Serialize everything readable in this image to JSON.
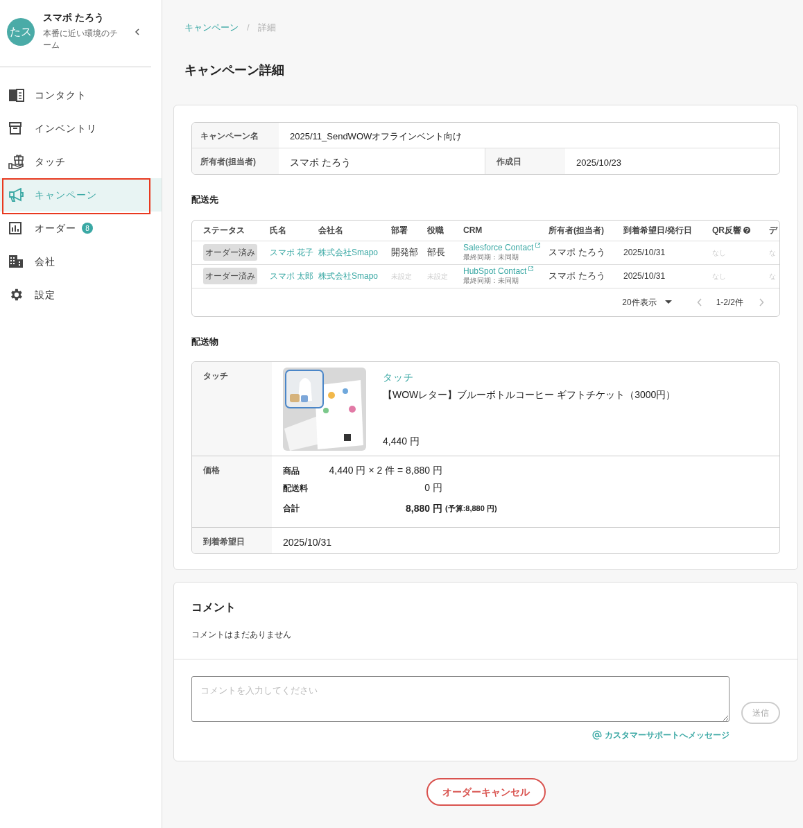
{
  "sidebar": {
    "user": {
      "avatar_text": "たス",
      "name": "スマポ たろう",
      "team": "本番に近い環境のチーム"
    },
    "nav": [
      {
        "label": "コンタクト",
        "selected": false,
        "annotated": false
      },
      {
        "label": "インベントリ",
        "selected": false,
        "annotated": false
      },
      {
        "label": "タッチ",
        "selected": false,
        "annotated": false
      },
      {
        "label": "キャンペーン",
        "selected": true,
        "annotated": true
      },
      {
        "label": "オーダー",
        "selected": false,
        "annotated": false,
        "badge": "8"
      },
      {
        "label": "会社",
        "selected": false,
        "annotated": false
      },
      {
        "label": "設定",
        "selected": false,
        "annotated": false
      }
    ]
  },
  "breadcrumb": [
    "キャンペーン",
    "詳細"
  ],
  "breadcrumb_separator": "/",
  "page_title": "キャンペーン詳細",
  "campaign": {
    "name_label": "キャンペーン名",
    "name": "2025/11_SendWOWオフラインベント向け",
    "owner_label": "所有者(担当者)",
    "owner": "スマポ たろう",
    "created_label": "作成日",
    "created": "2025/10/23"
  },
  "recipients": {
    "title": "配送先",
    "columns": [
      "ステータス",
      "氏名",
      "会社名",
      "部署",
      "役職",
      "CRM",
      "所有者(担当者)",
      "到着希望日/発行日",
      "QR反響",
      "デ"
    ],
    "rows": [
      {
        "status": "オーダー済み",
        "name": "スマポ 花子",
        "company": "株式会社Smapo",
        "department": "開発部",
        "department_muted": false,
        "role": "部長",
        "role_muted": false,
        "crm": "Salesforce Contact",
        "sync": "最終同期：未同期",
        "owner": "スマポ たろう",
        "date": "2025/10/31",
        "qr": "なし",
        "column_10": "な"
      },
      {
        "status": "オーダー済み",
        "name": "スマポ 太郎",
        "company": "株式会社Smapo",
        "department": "未設定",
        "department_muted": true,
        "role": "未設定",
        "role_muted": true,
        "crm": "HubSpot Contact",
        "sync": "最終同期：未同期",
        "owner": "スマポ たろう",
        "date": "2025/10/31",
        "qr": "なし",
        "column_10": "な"
      }
    ],
    "per_page": "20件表示",
    "range": "1-2/2件"
  },
  "shipment": {
    "title": "配送物",
    "touch_label": "タッチ",
    "category": "タッチ",
    "product": "【WOWレター】ブルーボトルコーヒー ギフトチケット（3000円）",
    "unit_price": "4,440 円",
    "price_label": "価格",
    "price_lines": [
      {
        "label": "商品",
        "value": "4,440 円 × 2 件 = 8,880 円",
        "kind": "plain"
      },
      {
        "label": "配送料",
        "value": "0 円",
        "kind": "plain"
      },
      {
        "label": "合計",
        "value": "8,880 円",
        "note": "(予算:8,880 円)",
        "kind": "total"
      }
    ],
    "arrival_label": "到着希望日",
    "arrival": "2025/10/31"
  },
  "comments": {
    "title": "コメント",
    "empty": "コメントはまだありません",
    "placeholder": "コメントを入力してください",
    "send": {
      "label": "送信",
      "disabled": true
    },
    "support_link": "カスタマーサポートへメッセージ"
  },
  "cancel_button": "オーダーキャンセル"
}
